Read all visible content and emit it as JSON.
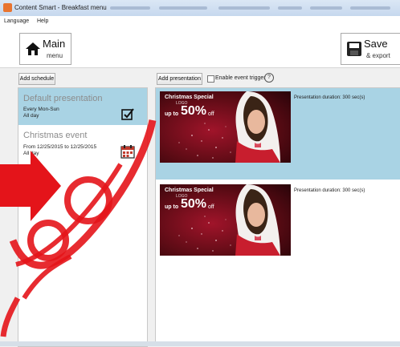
{
  "window": {
    "title": "Content Smart - Breakfast menu"
  },
  "menu": {
    "items": [
      "Language",
      "Help"
    ]
  },
  "ribbon": {
    "main_title": "Main",
    "main_sub": "menu",
    "save_title": "Save",
    "save_sub": "& export"
  },
  "schedule": {
    "add_label": "Add schedule",
    "items": [
      {
        "title": "Default presentation",
        "line1": "Every Mon-Sun",
        "line2": "All day",
        "selected": true
      },
      {
        "title": "Christmas event",
        "line1": "From 12/25/2015 to 12/25/2015",
        "line2": "All day",
        "selected": false
      }
    ]
  },
  "presentations": {
    "add_label": "Add presentation",
    "trigger_label": "Enable event trigger",
    "help_glyph": "?",
    "items": [
      {
        "duration": "Presentation duration: 300 sec(s)",
        "selected": true,
        "banner": "Christmas Special",
        "logo": "LOGO",
        "offer_pre": "up to",
        "offer_pct": "50%",
        "offer_post": "off"
      },
      {
        "duration": "Presentation duration: 300 sec(s)",
        "selected": false,
        "banner": "Christmas Special",
        "logo": "LOGO",
        "offer_pre": "up to",
        "offer_pct": "50%",
        "offer_post": "off"
      }
    ]
  },
  "colors": {
    "selected_bg": "#a9d3e4",
    "accent": "#e8742f",
    "thumb_bg": "#5a0b14"
  }
}
